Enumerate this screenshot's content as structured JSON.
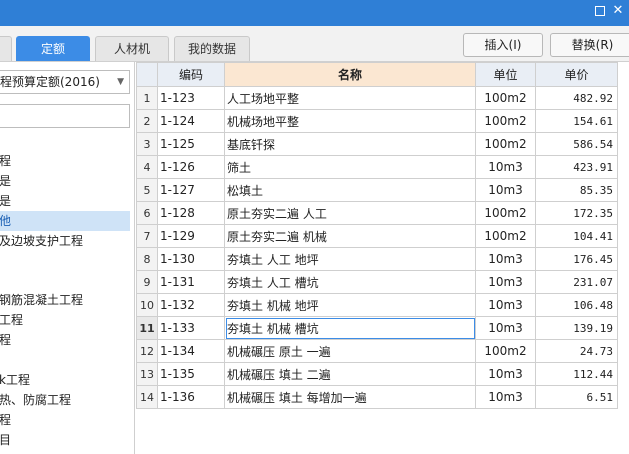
{
  "toolbar": {
    "tabs": [
      "",
      "定额",
      "人材机",
      "我的数据"
    ],
    "insert_label": "插入(I)",
    "replace_label": "替换(R)"
  },
  "left": {
    "quota_select": "程预算定额(2016)",
    "tree": [
      "程",
      "是",
      "是",
      "他",
      "及边坡支护工程",
      "钢筋混凝土工程",
      "工程",
      "程",
      "k工程",
      "热、防腐工程",
      "程",
      "目"
    ],
    "selected_index": 3
  },
  "grid": {
    "headers": [
      "",
      "编码",
      "名称",
      "单位",
      "单价"
    ],
    "rows": [
      {
        "no": "1",
        "code": "1-123",
        "name": "人工场地平整",
        "unit": "100m2",
        "price": "482.92"
      },
      {
        "no": "2",
        "code": "1-124",
        "name": "机械场地平整",
        "unit": "100m2",
        "price": "154.61"
      },
      {
        "no": "3",
        "code": "1-125",
        "name": "基底钎探",
        "unit": "100m2",
        "price": "586.54"
      },
      {
        "no": "4",
        "code": "1-126",
        "name": "筛土",
        "unit": "10m3",
        "price": "423.91"
      },
      {
        "no": "5",
        "code": "1-127",
        "name": "松填土",
        "unit": "10m3",
        "price": "85.35"
      },
      {
        "no": "6",
        "code": "1-128",
        "name": "原土夯实二遍 人工",
        "unit": "100m2",
        "price": "172.35"
      },
      {
        "no": "7",
        "code": "1-129",
        "name": "原土夯实二遍 机械",
        "unit": "100m2",
        "price": "104.41"
      },
      {
        "no": "8",
        "code": "1-130",
        "name": "夯填土 人工 地坪",
        "unit": "10m3",
        "price": "176.45"
      },
      {
        "no": "9",
        "code": "1-131",
        "name": "夯填土 人工 槽坑",
        "unit": "10m3",
        "price": "231.07"
      },
      {
        "no": "10",
        "code": "1-132",
        "name": "夯填土 机械 地坪",
        "unit": "10m3",
        "price": "106.48"
      },
      {
        "no": "11",
        "code": "1-133",
        "name": "夯填土 机械 槽坑",
        "unit": "10m3",
        "price": "139.19"
      },
      {
        "no": "12",
        "code": "1-134",
        "name": "机械碾压 原土 一遍",
        "unit": "100m2",
        "price": "24.73"
      },
      {
        "no": "13",
        "code": "1-135",
        "name": "机械碾压 填土 二遍",
        "unit": "10m3",
        "price": "112.44"
      },
      {
        "no": "14",
        "code": "1-136",
        "name": "机械碾压 填土 每增加一遍",
        "unit": "10m3",
        "price": "6.51"
      }
    ]
  }
}
